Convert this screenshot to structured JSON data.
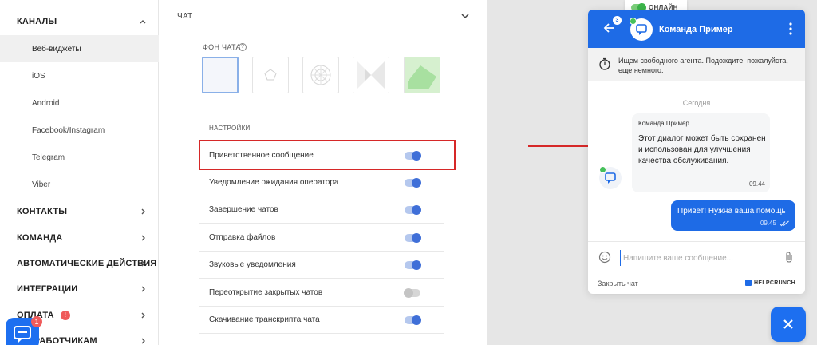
{
  "sidebar": {
    "sections": [
      {
        "label": "КАНАЛЫ",
        "expanded": true
      },
      {
        "label": "КОНТАКТЫ"
      },
      {
        "label": "КОМАНДА"
      },
      {
        "label": "АВТОМАТИЧЕСКИЕ ДЕЙСТВИЯ"
      },
      {
        "label": "ИНТЕГРАЦИИ"
      },
      {
        "label": "ОПЛАТА",
        "badge": "!"
      },
      {
        "label": "РАЗРАБОТЧИКАМ"
      }
    ],
    "channels": [
      {
        "label": "Веб-виджеты",
        "active": true
      },
      {
        "label": "iOS"
      },
      {
        "label": "Android"
      },
      {
        "label": "Facebook/Instagram"
      },
      {
        "label": "Telegram"
      },
      {
        "label": "Viber"
      }
    ],
    "chat_fab": {
      "badge": "1"
    }
  },
  "settings": {
    "title": "ЧАТ",
    "background_label": "ФОН ЧАТА",
    "help_glyph": "?",
    "section_label": "НАСТРОЙКИ",
    "rows": [
      {
        "label": "Приветственное сообщение",
        "enabled": true
      },
      {
        "label": "Уведомление ожидания оператора",
        "enabled": true
      },
      {
        "label": "Завершение чатов",
        "enabled": true
      },
      {
        "label": "Отправка файлов",
        "enabled": true
      },
      {
        "label": "Звуковые уведомления",
        "enabled": true
      },
      {
        "label": "Переоткрытие закрытых чатов",
        "enabled": false
      },
      {
        "label": "Скачивание транскрипта чата",
        "enabled": true
      }
    ]
  },
  "online_status": {
    "label": "ОНЛАЙН"
  },
  "widget": {
    "unread_count": "3",
    "team_name": "Команда Пример",
    "notice": "Ищем свободного агента. Подождите, пожалуйста, еще немного.",
    "date_label": "Сегодня",
    "incoming": {
      "author": "Команда Пример",
      "text": "Этот диалог может быть сохранен и использован для улучшения качества обслуживания.",
      "time": "09.44"
    },
    "outgoing": {
      "text": "Привет! Нужна ваша помощь",
      "time": "09.45"
    },
    "input_placeholder": "Напишите ваше сообщение...",
    "close_chat_label": "Закрыть чат",
    "brand": "HELPCRUNCH"
  },
  "colors": {
    "accent": "#1e6be6",
    "highlight": "#d62828",
    "online": "#46c05a",
    "warning": "#ef5b5b"
  }
}
